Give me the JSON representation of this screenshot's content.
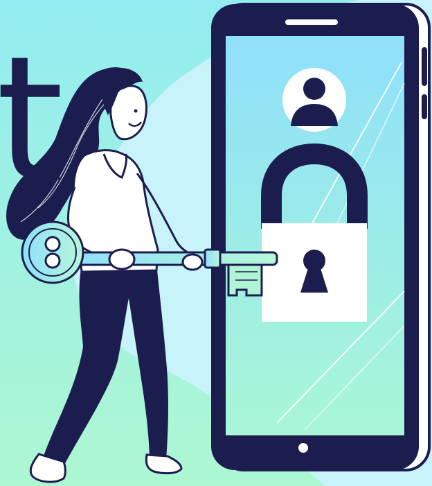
{
  "illustration": {
    "headline_fragment": "t",
    "colors": {
      "navy": "#1c1d4f",
      "mint_background": "#a9f5d8",
      "sky_blob": "#c7f3ff",
      "screen_top": "#8fe3fb",
      "screen_bottom": "#a8f7da",
      "white": "#ffffff"
    },
    "icons": [
      "user-avatar-icon",
      "padlock-icon",
      "key-icon"
    ]
  }
}
